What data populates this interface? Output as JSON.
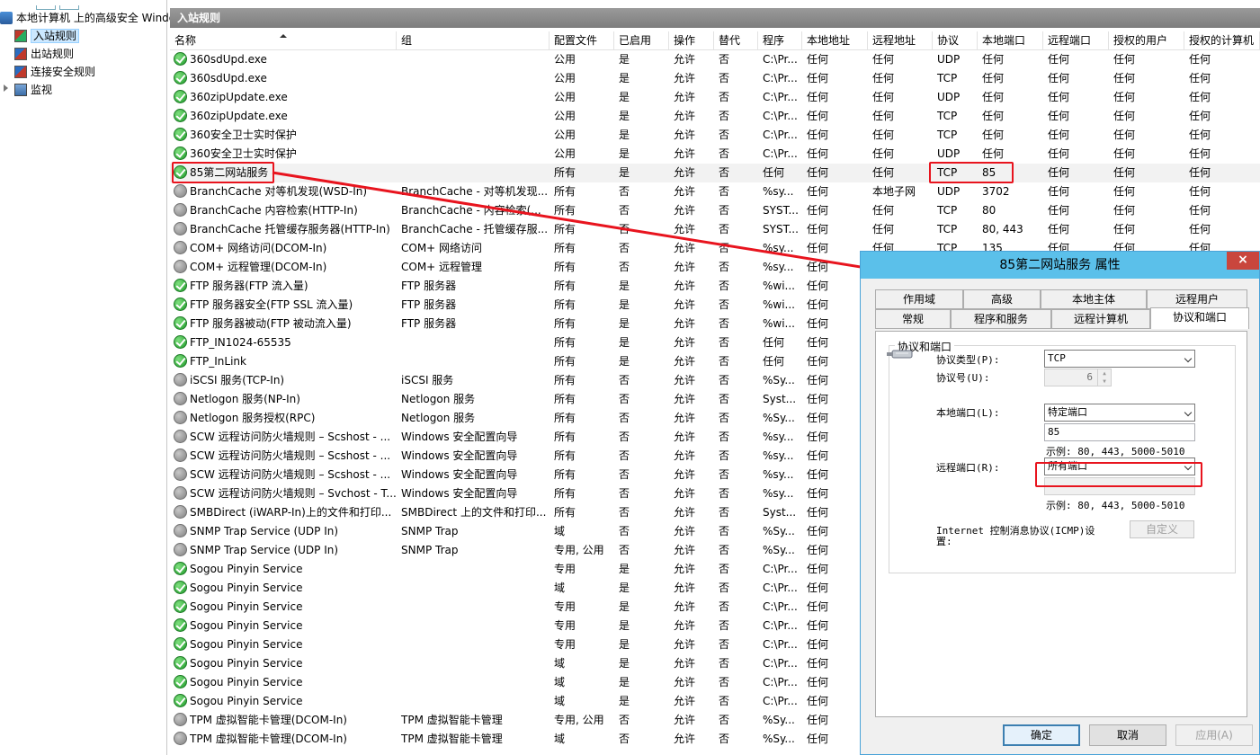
{
  "tree": {
    "root_label": "本地计算机 上的高级安全 Windows",
    "items": [
      {
        "label": "入站规则",
        "selected": true,
        "icon": "inbound-rules-icon"
      },
      {
        "label": "出站规则",
        "selected": false,
        "icon": "outbound-rules-icon"
      },
      {
        "label": "连接安全规则",
        "selected": false,
        "icon": "connection-security-icon"
      },
      {
        "label": "监视",
        "selected": false,
        "icon": "monitor-icon"
      }
    ]
  },
  "main": {
    "title": "入站规则",
    "columns": [
      "名称",
      "组",
      "配置文件",
      "已启用",
      "操作",
      "替代",
      "程序",
      "本地地址",
      "远程地址",
      "协议",
      "本地端口",
      "远程端口",
      "授权的用户",
      "授权的计算机"
    ],
    "rows": [
      {
        "on": true,
        "cells": [
          "360sdUpd.exe",
          "",
          "公用",
          "是",
          "允许",
          "否",
          "C:\\Pr...",
          "任何",
          "任何",
          "UDP",
          "任何",
          "任何",
          "任何",
          "任何"
        ]
      },
      {
        "on": true,
        "cells": [
          "360sdUpd.exe",
          "",
          "公用",
          "是",
          "允许",
          "否",
          "C:\\Pr...",
          "任何",
          "任何",
          "TCP",
          "任何",
          "任何",
          "任何",
          "任何"
        ]
      },
      {
        "on": true,
        "cells": [
          "360zipUpdate.exe",
          "",
          "公用",
          "是",
          "允许",
          "否",
          "C:\\Pr...",
          "任何",
          "任何",
          "UDP",
          "任何",
          "任何",
          "任何",
          "任何"
        ]
      },
      {
        "on": true,
        "cells": [
          "360zipUpdate.exe",
          "",
          "公用",
          "是",
          "允许",
          "否",
          "C:\\Pr...",
          "任何",
          "任何",
          "TCP",
          "任何",
          "任何",
          "任何",
          "任何"
        ]
      },
      {
        "on": true,
        "cells": [
          "360安全卫士实时保护",
          "",
          "公用",
          "是",
          "允许",
          "否",
          "C:\\Pr...",
          "任何",
          "任何",
          "TCP",
          "任何",
          "任何",
          "任何",
          "任何"
        ]
      },
      {
        "on": true,
        "cells": [
          "360安全卫士实时保护",
          "",
          "公用",
          "是",
          "允许",
          "否",
          "C:\\Pr...",
          "任何",
          "任何",
          "UDP",
          "任何",
          "任何",
          "任何",
          "任何"
        ]
      },
      {
        "on": true,
        "highlight": true,
        "cells": [
          "85第二网站服务",
          "",
          "所有",
          "是",
          "允许",
          "否",
          "任何",
          "任何",
          "任何",
          "TCP",
          "85",
          "任何",
          "任何",
          "任何"
        ]
      },
      {
        "on": false,
        "cells": [
          "BranchCache 对等机发现(WSD-In)",
          "BranchCache - 对等机发现...",
          "所有",
          "否",
          "允许",
          "否",
          "%sy...",
          "任何",
          "本地子网",
          "UDP",
          "3702",
          "任何",
          "任何",
          "任何"
        ]
      },
      {
        "on": false,
        "cells": [
          "BranchCache 内容检索(HTTP-In)",
          "BranchCache - 内容检索(...",
          "所有",
          "否",
          "允许",
          "否",
          "SYST...",
          "任何",
          "任何",
          "TCP",
          "80",
          "任何",
          "任何",
          "任何"
        ]
      },
      {
        "on": false,
        "cells": [
          "BranchCache 托管缓存服务器(HTTP-In)",
          "BranchCache - 托管缓存服...",
          "所有",
          "否",
          "允许",
          "否",
          "SYST...",
          "任何",
          "任何",
          "TCP",
          "80, 443",
          "任何",
          "任何",
          "任何"
        ]
      },
      {
        "on": false,
        "cells": [
          "COM+ 网络访问(DCOM-In)",
          "COM+ 网络访问",
          "所有",
          "否",
          "允许",
          "否",
          "%sy...",
          "任何",
          "任何",
          "TCP",
          "135",
          "任何",
          "任何",
          "任何"
        ]
      },
      {
        "on": false,
        "cells": [
          "COM+ 远程管理(DCOM-In)",
          "COM+ 远程管理",
          "所有",
          "否",
          "允许",
          "否",
          "%sy...",
          "任何",
          "",
          "",
          "",
          "",
          "",
          ""
        ]
      },
      {
        "on": true,
        "cells": [
          "FTP 服务器(FTP 流入量)",
          "FTP 服务器",
          "所有",
          "是",
          "允许",
          "否",
          "%wi...",
          "任何",
          "",
          "",
          "",
          "",
          "",
          ""
        ]
      },
      {
        "on": true,
        "cells": [
          "FTP 服务器安全(FTP SSL 流入量)",
          "FTP 服务器",
          "所有",
          "是",
          "允许",
          "否",
          "%wi...",
          "任何",
          "",
          "",
          "",
          "",
          "",
          ""
        ]
      },
      {
        "on": true,
        "cells": [
          "FTP 服务器被动(FTP 被动流入量)",
          "FTP 服务器",
          "所有",
          "是",
          "允许",
          "否",
          "%wi...",
          "任何",
          "",
          "",
          "",
          "",
          "",
          ""
        ]
      },
      {
        "on": true,
        "cells": [
          "FTP_IN1024-65535",
          "",
          "所有",
          "是",
          "允许",
          "否",
          "任何",
          "任何",
          "",
          "",
          "",
          "",
          "",
          ""
        ]
      },
      {
        "on": true,
        "cells": [
          "FTP_InLink",
          "",
          "所有",
          "是",
          "允许",
          "否",
          "任何",
          "任何",
          "",
          "",
          "",
          "",
          "",
          ""
        ]
      },
      {
        "on": false,
        "cells": [
          "iSCSI 服务(TCP-In)",
          "iSCSI 服务",
          "所有",
          "否",
          "允许",
          "否",
          "%Sy...",
          "任何",
          "",
          "",
          "",
          "",
          "",
          ""
        ]
      },
      {
        "on": false,
        "cells": [
          "Netlogon 服务(NP-In)",
          "Netlogon 服务",
          "所有",
          "否",
          "允许",
          "否",
          "Syst...",
          "任何",
          "",
          "",
          "",
          "",
          "",
          ""
        ]
      },
      {
        "on": false,
        "cells": [
          "Netlogon 服务授权(RPC)",
          "Netlogon 服务",
          "所有",
          "否",
          "允许",
          "否",
          "%Sy...",
          "任何",
          "",
          "",
          "",
          "",
          "",
          ""
        ]
      },
      {
        "on": false,
        "cells": [
          "SCW 远程访问防火墙规则 – Scshost - ...",
          "Windows 安全配置向导",
          "所有",
          "否",
          "允许",
          "否",
          "%sy...",
          "任何",
          "",
          "",
          "",
          "",
          "",
          ""
        ]
      },
      {
        "on": false,
        "cells": [
          "SCW 远程访问防火墙规则 – Scshost - ...",
          "Windows 安全配置向导",
          "所有",
          "否",
          "允许",
          "否",
          "%sy...",
          "任何",
          "",
          "",
          "",
          "",
          "",
          ""
        ]
      },
      {
        "on": false,
        "cells": [
          "SCW 远程访问防火墙规则 – Scshost - ...",
          "Windows 安全配置向导",
          "所有",
          "否",
          "允许",
          "否",
          "%sy...",
          "任何",
          "",
          "",
          "",
          "",
          "",
          ""
        ]
      },
      {
        "on": false,
        "cells": [
          "SCW 远程访问防火墙规则 – Svchost - T...",
          "Windows 安全配置向导",
          "所有",
          "否",
          "允许",
          "否",
          "%sy...",
          "任何",
          "",
          "",
          "",
          "",
          "",
          ""
        ]
      },
      {
        "on": false,
        "cells": [
          "SMBDirect (iWARP-In)上的文件和打印...",
          "SMBDirect 上的文件和打印...",
          "所有",
          "否",
          "允许",
          "否",
          "Syst...",
          "任何",
          "",
          "",
          "",
          "",
          "",
          ""
        ]
      },
      {
        "on": false,
        "cells": [
          "SNMP Trap Service (UDP In)",
          "SNMP Trap",
          "域",
          "否",
          "允许",
          "否",
          "%Sy...",
          "任何",
          "",
          "",
          "",
          "",
          "",
          ""
        ]
      },
      {
        "on": false,
        "cells": [
          "SNMP Trap Service (UDP In)",
          "SNMP Trap",
          "专用, 公用",
          "否",
          "允许",
          "否",
          "%Sy...",
          "任何",
          "",
          "",
          "",
          "",
          "",
          ""
        ]
      },
      {
        "on": true,
        "cells": [
          "Sogou Pinyin Service",
          "",
          "专用",
          "是",
          "允许",
          "否",
          "C:\\Pr...",
          "任何",
          "",
          "",
          "",
          "",
          "",
          ""
        ]
      },
      {
        "on": true,
        "cells": [
          "Sogou Pinyin Service",
          "",
          "域",
          "是",
          "允许",
          "否",
          "C:\\Pr...",
          "任何",
          "",
          "",
          "",
          "",
          "",
          ""
        ]
      },
      {
        "on": true,
        "cells": [
          "Sogou Pinyin Service",
          "",
          "专用",
          "是",
          "允许",
          "否",
          "C:\\Pr...",
          "任何",
          "",
          "",
          "",
          "",
          "",
          ""
        ]
      },
      {
        "on": true,
        "cells": [
          "Sogou Pinyin Service",
          "",
          "专用",
          "是",
          "允许",
          "否",
          "C:\\Pr...",
          "任何",
          "",
          "",
          "",
          "",
          "",
          ""
        ]
      },
      {
        "on": true,
        "cells": [
          "Sogou Pinyin Service",
          "",
          "专用",
          "是",
          "允许",
          "否",
          "C:\\Pr...",
          "任何",
          "",
          "",
          "",
          "",
          "",
          ""
        ]
      },
      {
        "on": true,
        "cells": [
          "Sogou Pinyin Service",
          "",
          "域",
          "是",
          "允许",
          "否",
          "C:\\Pr...",
          "任何",
          "",
          "",
          "",
          "",
          "",
          ""
        ]
      },
      {
        "on": true,
        "cells": [
          "Sogou Pinyin Service",
          "",
          "域",
          "是",
          "允许",
          "否",
          "C:\\Pr...",
          "任何",
          "",
          "",
          "",
          "",
          "",
          ""
        ]
      },
      {
        "on": true,
        "cells": [
          "Sogou Pinyin Service",
          "",
          "域",
          "是",
          "允许",
          "否",
          "C:\\Pr...",
          "任何",
          "",
          "",
          "",
          "",
          "",
          ""
        ]
      },
      {
        "on": false,
        "cells": [
          "TPM 虚拟智能卡管理(DCOM-In)",
          "TPM 虚拟智能卡管理",
          "专用, 公用",
          "否",
          "允许",
          "否",
          "%Sy...",
          "任何",
          "",
          "",
          "",
          "",
          "",
          ""
        ]
      },
      {
        "on": false,
        "cells": [
          "TPM 虚拟智能卡管理(DCOM-In)",
          "TPM 虚拟智能卡管理",
          "域",
          "否",
          "允许",
          "否",
          "%Sy...",
          "任何",
          "",
          "",
          "",
          "",
          "",
          ""
        ]
      }
    ]
  },
  "dialog": {
    "title": "85第二网站服务 属性",
    "close": "×",
    "tabs_row1": [
      "作用域",
      "高级",
      "本地主体",
      "远程用户"
    ],
    "tabs_row2": [
      "常规",
      "程序和服务",
      "远程计算机",
      "协议和端口"
    ],
    "group_title": "协议和端口",
    "protocol_type_label": "协议类型(P):",
    "protocol_type_value": "TCP",
    "protocol_number_label": "协议号(U):",
    "protocol_number_value": "6",
    "local_port_label": "本地端口(L):",
    "local_port_value": "特定端口",
    "local_port_text": "85",
    "local_example": "示例: 80, 443, 5000-5010",
    "remote_port_label": "远程端口(R):",
    "remote_port_value": "所有端口",
    "remote_example": "示例: 80, 443, 5000-5010",
    "icmp_label_1": "Internet 控制消息协议(ICMP)设",
    "icmp_label_2": "置:",
    "customize_label": "自定义",
    "ok_label": "确定",
    "cancel_label": "取消",
    "apply_label": "应用(A)"
  },
  "colors": {
    "annotation_red": "#e8141e",
    "dialog_title": "#5bc0ea",
    "header_gray": "#8a8a8a"
  }
}
